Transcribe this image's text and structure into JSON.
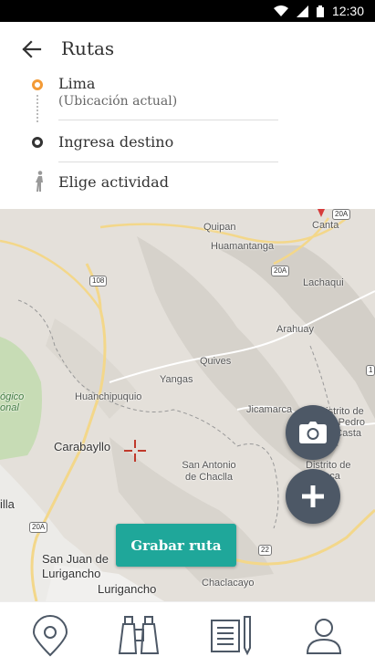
{
  "status_bar": {
    "time": "12:30",
    "icons": [
      "wifi-icon",
      "signal-icon",
      "battery-icon"
    ]
  },
  "header": {
    "title": "Rutas",
    "origin": {
      "name": "Lima",
      "subtitle": "(Ubicación actual)"
    },
    "destination": {
      "placeholder": "Ingresa destino"
    },
    "activity": {
      "label": "Elige actividad"
    }
  },
  "map": {
    "places": [
      "Quipan",
      "Canta",
      "Huamantanga",
      "Lachaqui",
      "Arahuay",
      "Quives",
      "Yangas",
      "Huanchipuquio",
      "Jicamarca",
      "Distrito de San Pedro de Casta",
      "Carabayllo",
      "San Antonio de Chaclla",
      "Distrito de Huanca",
      "San Juan de Lurigancho",
      "Lurigancho",
      "Chaclacayo",
      "illa",
      "ógico onal"
    ],
    "road_shields": [
      "108",
      "20A",
      "20A",
      "22",
      "20A",
      "1"
    ],
    "record_button": "Grabar ruta"
  },
  "bottom_nav": {
    "items": [
      "location-icon",
      "binoculars-icon",
      "notes-icon",
      "profile-icon"
    ]
  },
  "colors": {
    "accent": "#1fa79a",
    "origin": "#f39a36",
    "fab": "#4d5866"
  }
}
